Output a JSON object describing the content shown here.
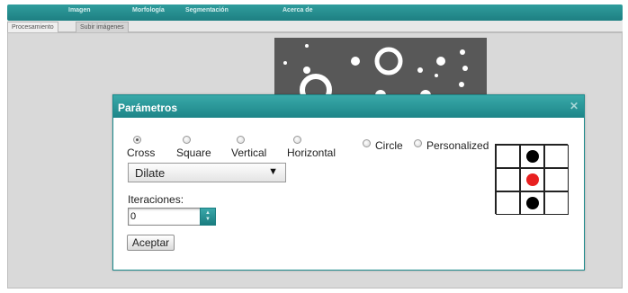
{
  "menubar": {
    "items": [
      "Imagen",
      "Morfología",
      "Segmentación",
      "Acerca de"
    ]
  },
  "tabs": [
    {
      "label": "Procesamiento",
      "active": true
    },
    {
      "label": "Subir imágenes",
      "active": false
    }
  ],
  "dialog": {
    "title": "Parámetros",
    "close_icon": "close-icon",
    "shapes": [
      {
        "label": "Cross",
        "checked": true
      },
      {
        "label": "Square",
        "checked": false
      },
      {
        "label": "Vertical",
        "checked": false
      },
      {
        "label": "Horizontal",
        "checked": false
      },
      {
        "label": "Circle",
        "checked": false
      },
      {
        "label": "Personalized",
        "checked": false
      }
    ],
    "operation": {
      "selected": "Dilate"
    },
    "iterations": {
      "label": "Iteraciones:",
      "value": "0"
    },
    "accept_label": "Aceptar",
    "structuring_element": [
      [
        0,
        1,
        0
      ],
      [
        0,
        2,
        0
      ],
      [
        0,
        1,
        0
      ]
    ]
  },
  "colors": {
    "accent": "#1e8588",
    "panel": "#d9d9d9",
    "center_dot": "#e82020",
    "dot": "#000000"
  }
}
